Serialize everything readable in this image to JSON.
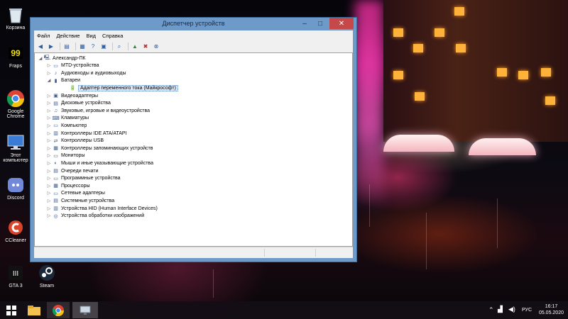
{
  "desktop": {
    "icons": [
      {
        "label": "Корзина",
        "icon": "recycle-bin-icon"
      },
      {
        "label": "Fraps",
        "icon": "fraps-icon"
      },
      {
        "label": "Google Chrome",
        "icon": "chrome-icon"
      },
      {
        "label": "Этот компьютер",
        "icon": "computer-icon"
      },
      {
        "label": "Discord",
        "icon": "discord-icon"
      },
      {
        "label": "CCleaner",
        "icon": "ccleaner-icon"
      },
      {
        "label": "GTA 3",
        "icon": "gta3-icon"
      },
      {
        "label": "Steam",
        "icon": "steam-icon"
      }
    ],
    "fraps_counter": "99"
  },
  "window": {
    "title": "Диспетчер устройств",
    "menu": [
      "Файл",
      "Действие",
      "Вид",
      "Справка"
    ],
    "toolbar_icons": [
      "back-icon",
      "forward-icon",
      "tree-view-icon",
      "properties-icon",
      "help-icon",
      "details-icon",
      "scan-hardware-icon",
      "update-driver-icon",
      "disable-device-icon",
      "uninstall-device-icon"
    ],
    "root": "Александр-ПК",
    "categories": [
      {
        "label": "MTD-устройства",
        "expanded": false
      },
      {
        "label": "Аудиовходы и аудиовыходы",
        "expanded": false
      },
      {
        "label": "Батареи",
        "expanded": true,
        "children": [
          "Адаптер переменного тока (Майкрософт)"
        ]
      },
      {
        "label": "Видеоадаптеры",
        "expanded": false
      },
      {
        "label": "Дисковые устройства",
        "expanded": false
      },
      {
        "label": "Звуковые, игровые и видеоустройства",
        "expanded": false
      },
      {
        "label": "Клавиатуры",
        "expanded": false
      },
      {
        "label": "Компьютер",
        "expanded": false
      },
      {
        "label": "Контроллеры IDE ATA/ATAPI",
        "expanded": false
      },
      {
        "label": "Контроллеры USB",
        "expanded": false
      },
      {
        "label": "Контроллеры запоминающих устройств",
        "expanded": false
      },
      {
        "label": "Мониторы",
        "expanded": false
      },
      {
        "label": "Мыши и иные указывающие устройства",
        "expanded": false
      },
      {
        "label": "Очереди печати",
        "expanded": false
      },
      {
        "label": "Программные устройства",
        "expanded": false
      },
      {
        "label": "Процессоры",
        "expanded": false
      },
      {
        "label": "Сетевые адаптеры",
        "expanded": false
      },
      {
        "label": "Системные устройства",
        "expanded": false
      },
      {
        "label": "Устройства HID (Human Interface Devices)",
        "expanded": false
      },
      {
        "label": "Устройства обработки изображений",
        "expanded": false
      }
    ],
    "selected_item": "Адаптер переменного тока (Майкрософт)"
  },
  "taskbar": {
    "items": [
      "start-icon",
      "file-explorer-icon",
      "chrome-icon",
      "device-manager-icon"
    ],
    "language": "РУС",
    "time": "16:17",
    "date": "05.05.2020"
  }
}
